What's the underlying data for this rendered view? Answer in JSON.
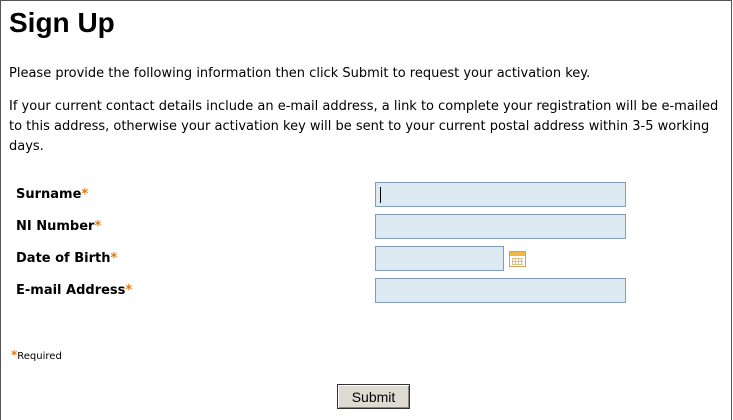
{
  "page": {
    "title": "Sign Up",
    "intro": "Please provide the following information then click Submit to request your activation key.",
    "details": "If your current contact details include an e-mail address, a link to complete your registration will be e-mailed to this address, otherwise your activation key will be sent to your current postal address within 3-5 working days."
  },
  "form": {
    "required_marker": "*",
    "fields": [
      {
        "label": "Surname",
        "value": ""
      },
      {
        "label": "NI Number",
        "value": ""
      },
      {
        "label": "Date of Birth",
        "value": ""
      },
      {
        "label": "E-mail Address",
        "value": ""
      }
    ],
    "calendar_icon": "calendar-icon",
    "required_note": "Required",
    "submit_label": "Submit"
  },
  "colors": {
    "required_marker": "#e07a10",
    "field_background": "#dde9f3",
    "field_border": "#7f9db9",
    "button_background": "#dedbd3"
  }
}
